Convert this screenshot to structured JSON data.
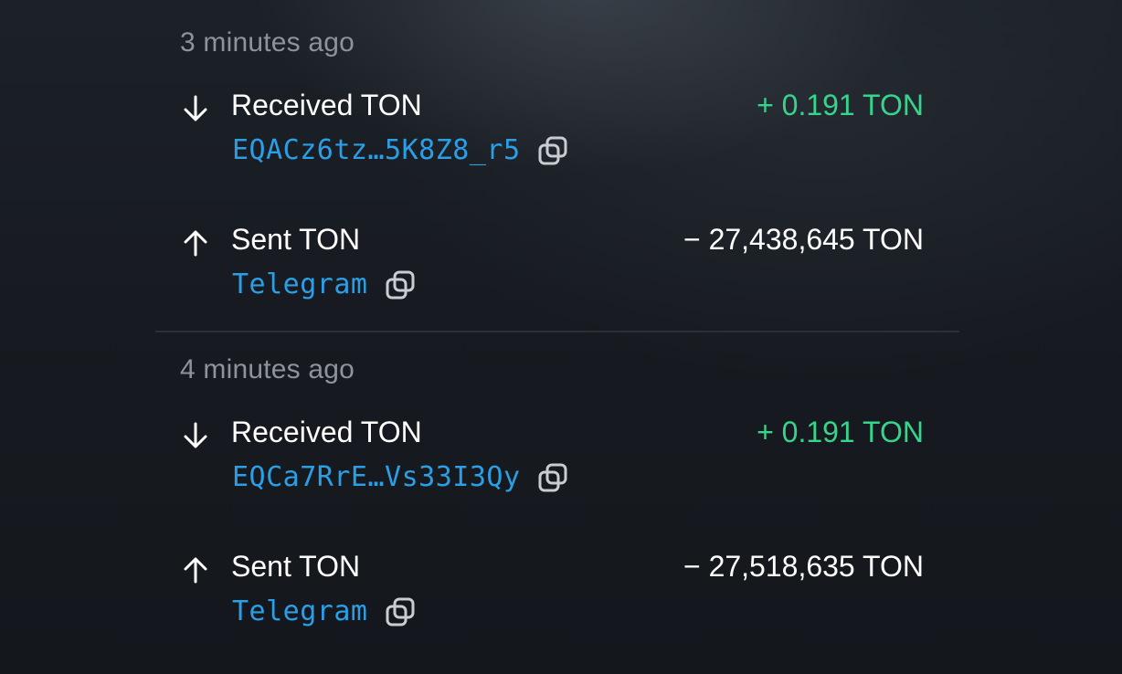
{
  "groups": [
    {
      "time": "3 minutes ago",
      "transactions": [
        {
          "direction": "in",
          "icon": "arrow-down-icon",
          "title": "Received TON",
          "sign": "+",
          "amount": "0.191 TON",
          "counterparty": "EQACz6tz…5K8Z8_r5"
        },
        {
          "direction": "out",
          "icon": "arrow-up-icon",
          "title": "Sent TON",
          "sign": "−",
          "amount": "27,438,645 TON",
          "counterparty": "Telegram"
        }
      ]
    },
    {
      "time": "4 minutes ago",
      "transactions": [
        {
          "direction": "in",
          "icon": "arrow-down-icon",
          "title": "Received TON",
          "sign": "+",
          "amount": "0.191 TON",
          "counterparty": "EQCa7RrE…Vs33I3Qy"
        },
        {
          "direction": "out",
          "icon": "arrow-up-icon",
          "title": "Sent TON",
          "sign": "−",
          "amount": "27,518,635 TON",
          "counterparty": "Telegram"
        }
      ]
    }
  ],
  "colors": {
    "incoming_amount": "#37d48b",
    "address_link": "#2b9fe6",
    "timestamp": "#8d939b",
    "background": "#171b21"
  }
}
